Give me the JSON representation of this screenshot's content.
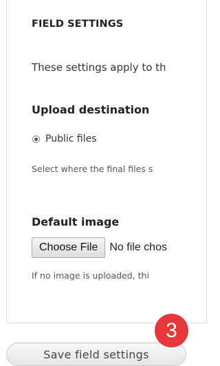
{
  "panel": {
    "title": "FIELD SETTINGS",
    "intro": "These settings apply to th"
  },
  "upload_destination": {
    "label": "Upload destination",
    "option_label": "Public files",
    "option_selected": true,
    "help": "Select where the final files s"
  },
  "default_image": {
    "label": "Default image",
    "choose_file_label": "Choose File",
    "file_status": "No file chos",
    "help": "If no image is uploaded, thi"
  },
  "save_button": {
    "label": "Save field settings"
  },
  "step_badge": {
    "number": "3",
    "color": "#e5383b"
  },
  "colors": {
    "panel_border": "#dcdcdc",
    "text": "#333333"
  }
}
